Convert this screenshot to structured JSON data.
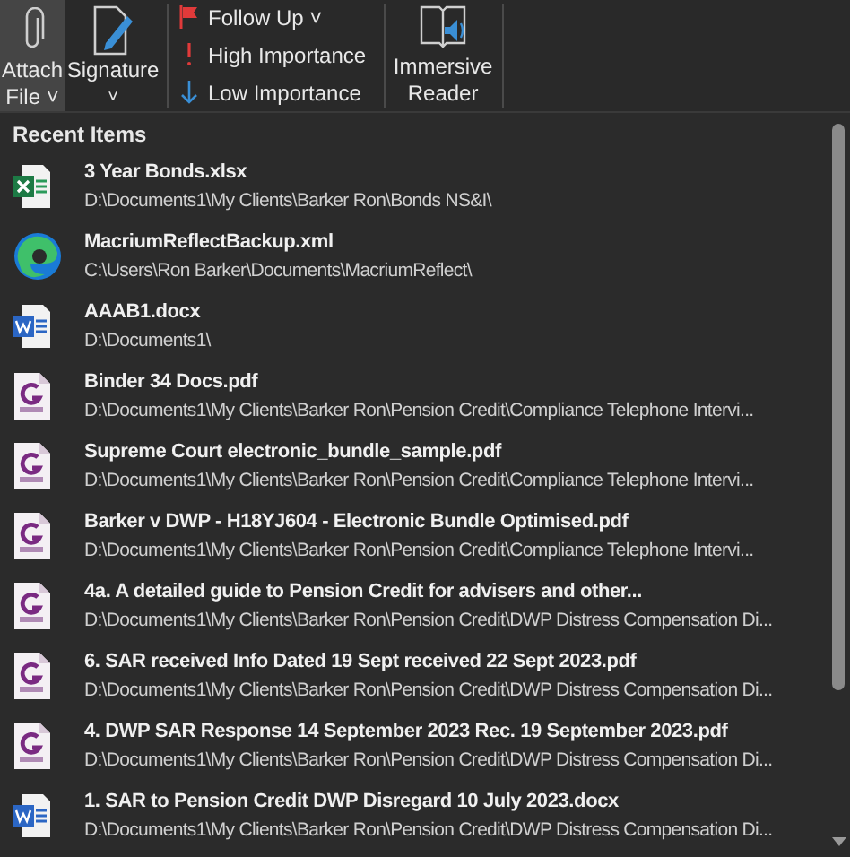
{
  "ribbon": {
    "buttons": [
      {
        "kind": "attach",
        "label": "Attach",
        "label2": "File",
        "caret": "˅",
        "selected": true
      },
      {
        "kind": "signature",
        "label": "Signature",
        "caret": "˅",
        "selected": false
      }
    ],
    "tags": [
      {
        "kind": "flag",
        "label": "Follow Up",
        "caret": "˅"
      },
      {
        "kind": "high",
        "label": "High Importance"
      },
      {
        "kind": "low",
        "label": "Low Importance"
      }
    ],
    "reader": {
      "label": "Immersive",
      "label2": "Reader"
    }
  },
  "menu": {
    "heading": "Recent Items",
    "items": [
      {
        "kind": "excel",
        "name": "3 Year Bonds.xlsx",
        "path": "D:\\Documents1\\My Clients\\Barker Ron\\Bonds NS&I\\"
      },
      {
        "kind": "edge",
        "name": "MacriumReflectBackup.xml",
        "path": "C:\\Users\\Ron Barker\\Documents\\MacriumReflect\\"
      },
      {
        "kind": "word",
        "name": "AAAB1.docx",
        "path": "D:\\Documents1\\"
      },
      {
        "kind": "pdf",
        "name": "Binder 34 Docs.pdf",
        "path": "D:\\Documents1\\My Clients\\Barker Ron\\Pension Credit\\Compliance Telephone Intervi..."
      },
      {
        "kind": "pdf",
        "name": "Supreme Court electronic_bundle_sample.pdf",
        "path": "D:\\Documents1\\My Clients\\Barker Ron\\Pension Credit\\Compliance Telephone Intervi..."
      },
      {
        "kind": "pdf",
        "name": "Barker v DWP - H18YJ604 - Electronic Bundle Optimised.pdf",
        "path": "D:\\Documents1\\My Clients\\Barker Ron\\Pension Credit\\Compliance Telephone Intervi..."
      },
      {
        "kind": "pdf",
        "name": "4a.  A detailed guide to Pension Credit for advisers and other...",
        "path": "D:\\Documents1\\My Clients\\Barker Ron\\Pension Credit\\DWP Distress Compensation Di..."
      },
      {
        "kind": "pdf",
        "name": "6. SAR received Info Dated 19 Sept received 22 Sept 2023.pdf",
        "path": "D:\\Documents1\\My Clients\\Barker Ron\\Pension Credit\\DWP Distress Compensation Di..."
      },
      {
        "kind": "pdf",
        "name": "4. DWP SAR Response 14 September 2023 Rec. 19 September 2023.pdf",
        "path": "D:\\Documents1\\My Clients\\Barker Ron\\Pension Credit\\DWP Distress Compensation Di..."
      },
      {
        "kind": "word",
        "name": "1. SAR to Pension Credit DWP Disregard 10 July 2023.docx",
        "path": "D:\\Documents1\\My Clients\\Barker Ron\\Pension Credit\\DWP Distress Compensation Di..."
      }
    ]
  }
}
